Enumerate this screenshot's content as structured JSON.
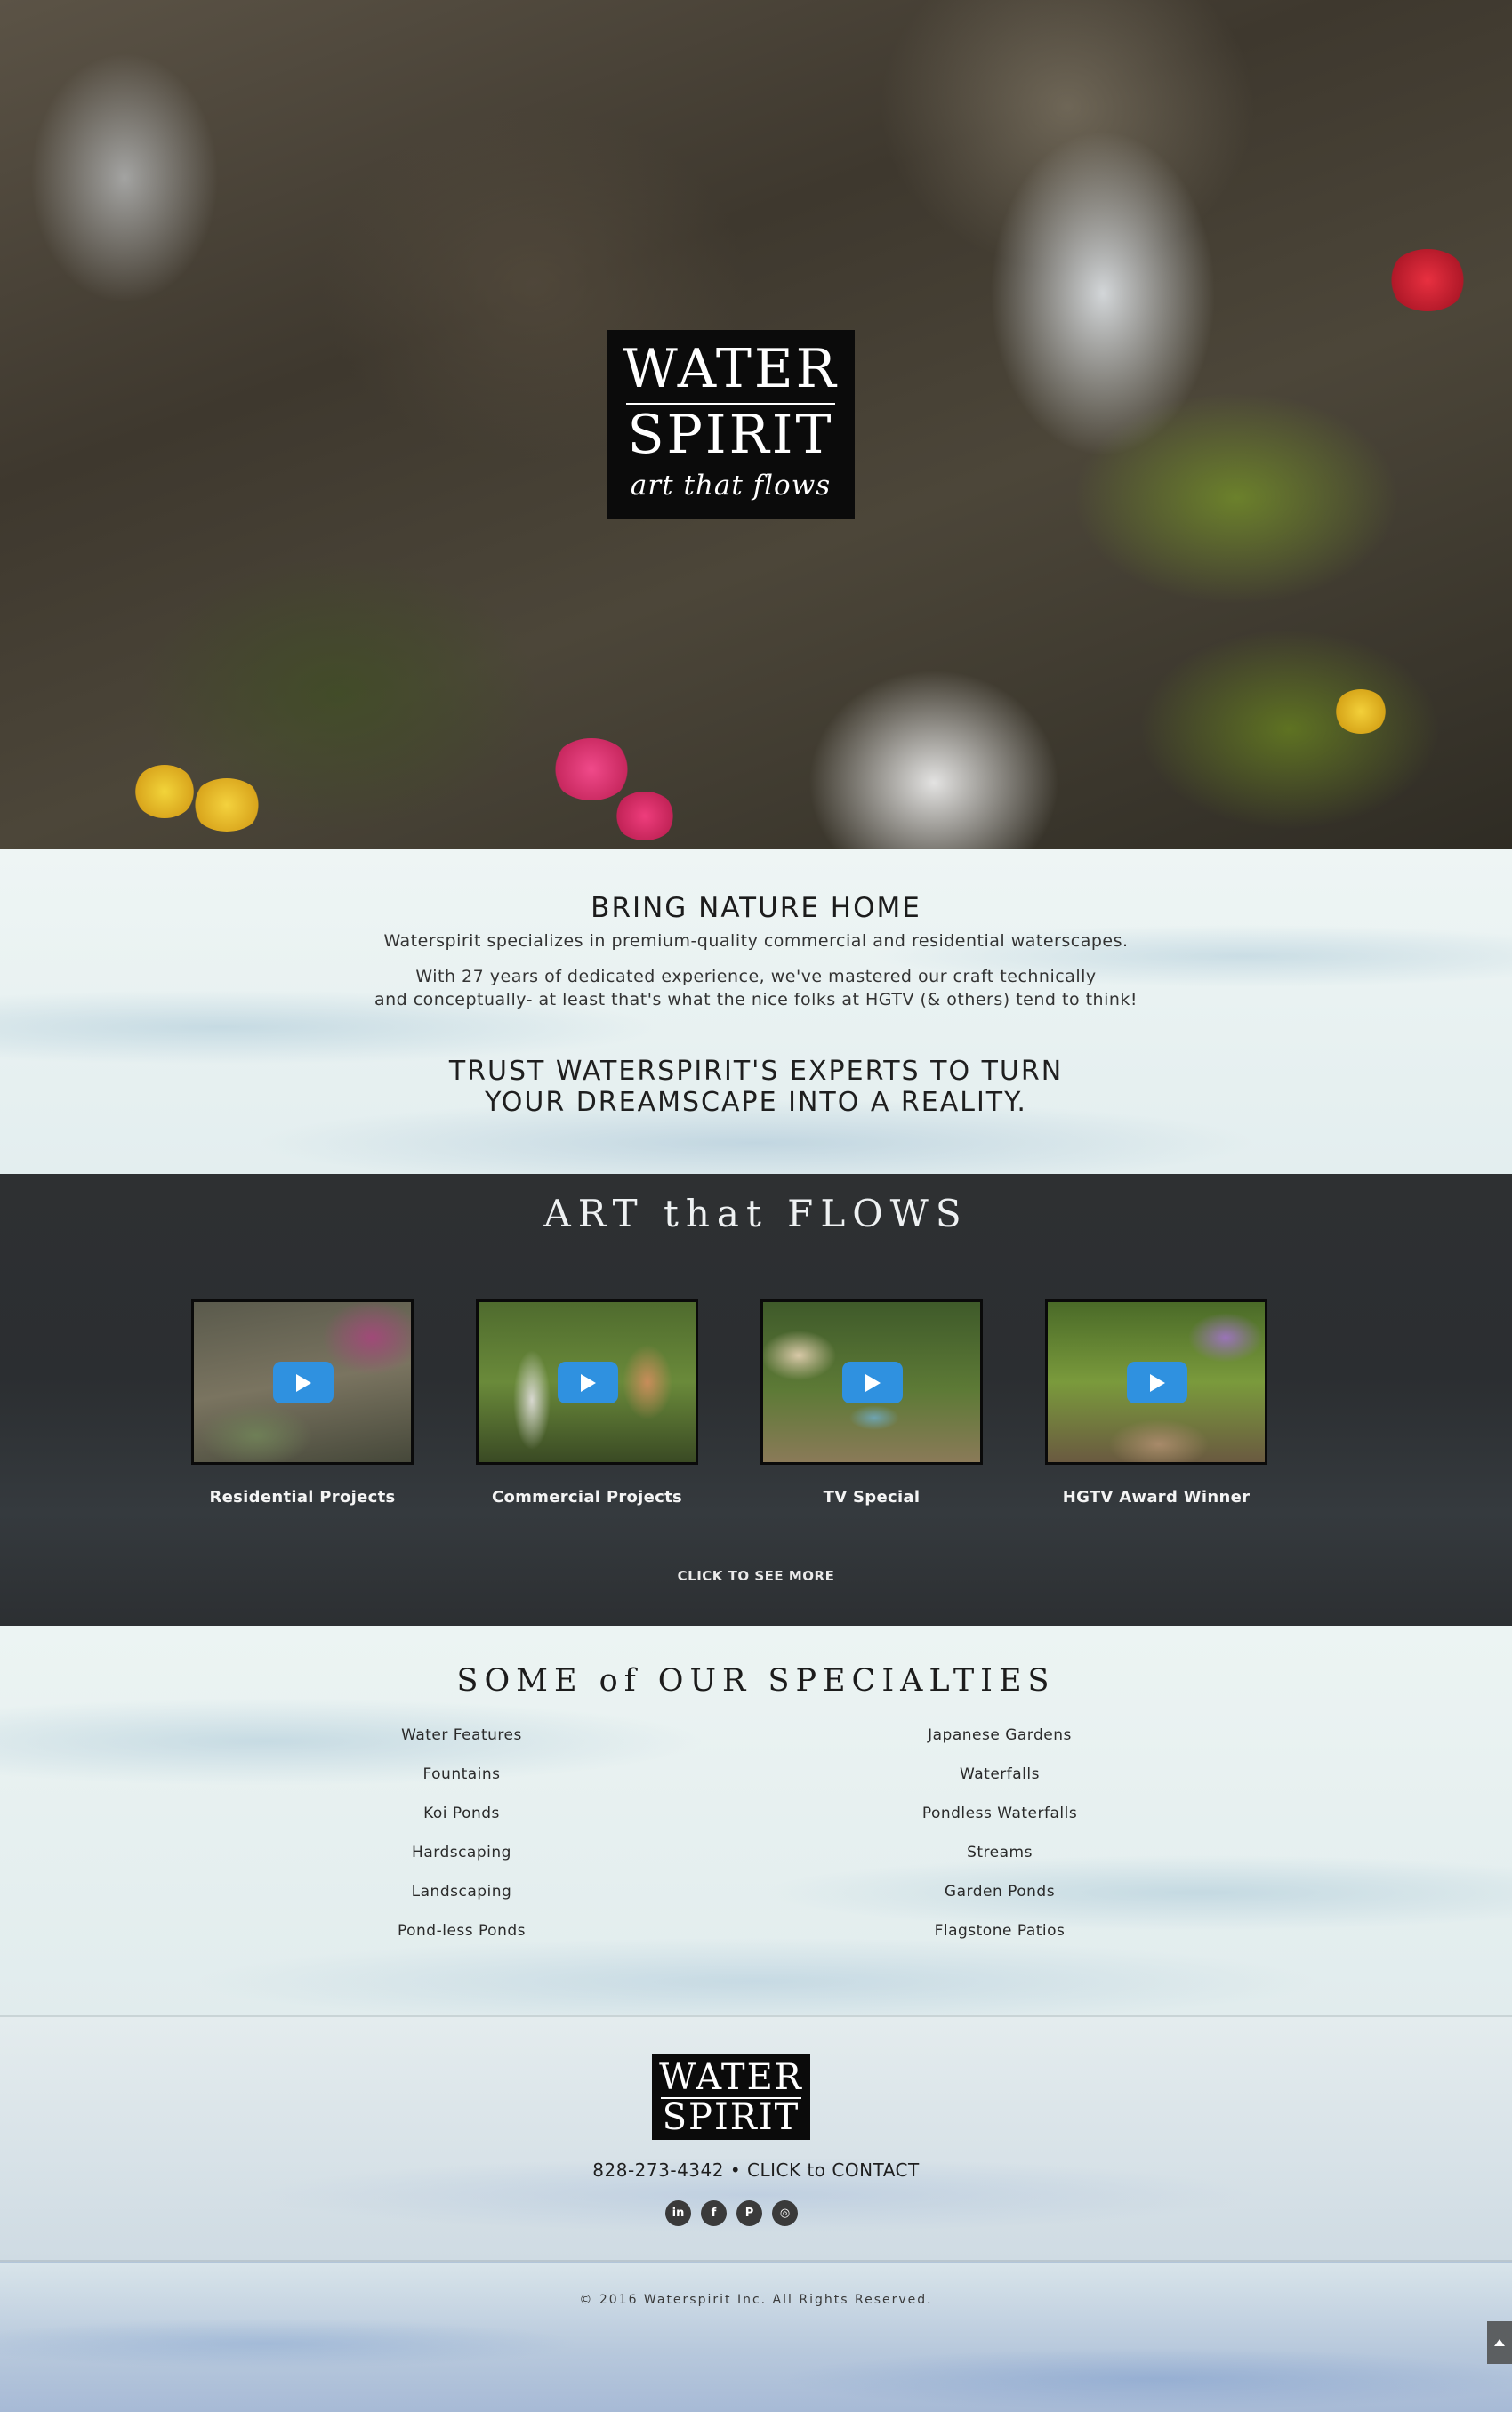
{
  "hero": {
    "logo_line1": "WATER",
    "logo_line2": "SPIRIT",
    "logo_tagline": "art that flows"
  },
  "intro": {
    "heading": "BRING NATURE HOME",
    "line1": "Waterspirit specializes in premium-quality commercial and residential waterscapes.",
    "line2": "With 27 years of dedicated experience, we've mastered our craft technically",
    "line3": "and conceptually- at least that's what the nice folks at HGTV (& others) tend to think!",
    "trust_line1": "TRUST WATERSPIRIT'S EXPERTS TO TURN",
    "trust_line2": "YOUR DREAMSCAPE INTO A REALITY."
  },
  "videos": {
    "heading": "ART that FLOWS",
    "items": [
      {
        "label": "Residential Projects"
      },
      {
        "label": "Commercial Projects"
      },
      {
        "label": "TV Special"
      },
      {
        "label": "HGTV Award Winner"
      }
    ],
    "more_label": "CLICK TO SEE MORE"
  },
  "specialties": {
    "heading": "SOME of OUR SPECIALTIES",
    "left": [
      "Water Features",
      "Fountains",
      "Koi Ponds",
      "Hardscaping",
      "Landscaping",
      "Pond-less Ponds"
    ],
    "right": [
      "Japanese Gardens",
      "Waterfalls",
      "Pondless Waterfalls",
      "Streams",
      "Garden Ponds",
      "Flagstone Patios"
    ]
  },
  "footer": {
    "logo_line1": "WATER",
    "logo_line2": "SPIRIT",
    "phone": "828-273-4342",
    "separator": " • ",
    "contact_label": "CLICK to CONTACT",
    "social": [
      {
        "name": "linkedin-icon",
        "glyph": "in"
      },
      {
        "name": "facebook-icon",
        "glyph": "f"
      },
      {
        "name": "pinterest-icon",
        "glyph": "P"
      },
      {
        "name": "instagram-icon",
        "glyph": "◎"
      }
    ],
    "copyright": "© 2016 Waterspirit Inc. All Rights Reserved."
  },
  "colors": {
    "play_button": "#2f91e0",
    "band_bg": "#2e3032",
    "logo_bg": "#0b0b0b"
  }
}
